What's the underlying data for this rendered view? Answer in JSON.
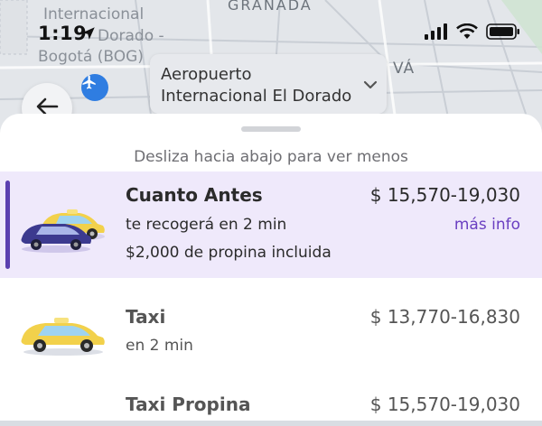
{
  "map": {
    "labels": {
      "internacional": "Internacional",
      "dorado_frag": "Dorado -",
      "bogota": "Bogotá (BOG)",
      "granada": "GRANADA",
      "va": "VÁ"
    }
  },
  "status_bar": {
    "time": "1:19"
  },
  "destination": {
    "line1": "Aeropuerto",
    "line2": "Internacional El Dorado"
  },
  "sheet": {
    "hint": "Desliza hacia abajo para ver menos",
    "rides": [
      {
        "name": "Cuanto Antes",
        "price": "$ 15,570-19,030",
        "eta": "te recogerá en 2 min",
        "extra": "$2,000 de propina incluida",
        "more_info": "más info",
        "selected": true
      },
      {
        "name": "Taxi",
        "price": "$ 13,770-16,830",
        "eta": "en 2 min",
        "selected": false
      },
      {
        "name": "Taxi Propina",
        "price": "$ 15,570-19,030",
        "selected": false
      }
    ]
  },
  "colors": {
    "accent": "#6a3fc1",
    "selected_bg": "#efe9fb",
    "selected_bar": "#5b3fb0",
    "pin_blue": "#2f7de1",
    "taxi_yellow": "#f2d14b",
    "dark_car": "#3c3a8f"
  },
  "icons": [
    "location-arrow-icon",
    "signal-icon",
    "wifi-icon",
    "battery-icon",
    "airport-pin-icon",
    "chevron-down-icon",
    "back-arrow-icon",
    "taxi-car-icon",
    "dark-car-icon"
  ]
}
